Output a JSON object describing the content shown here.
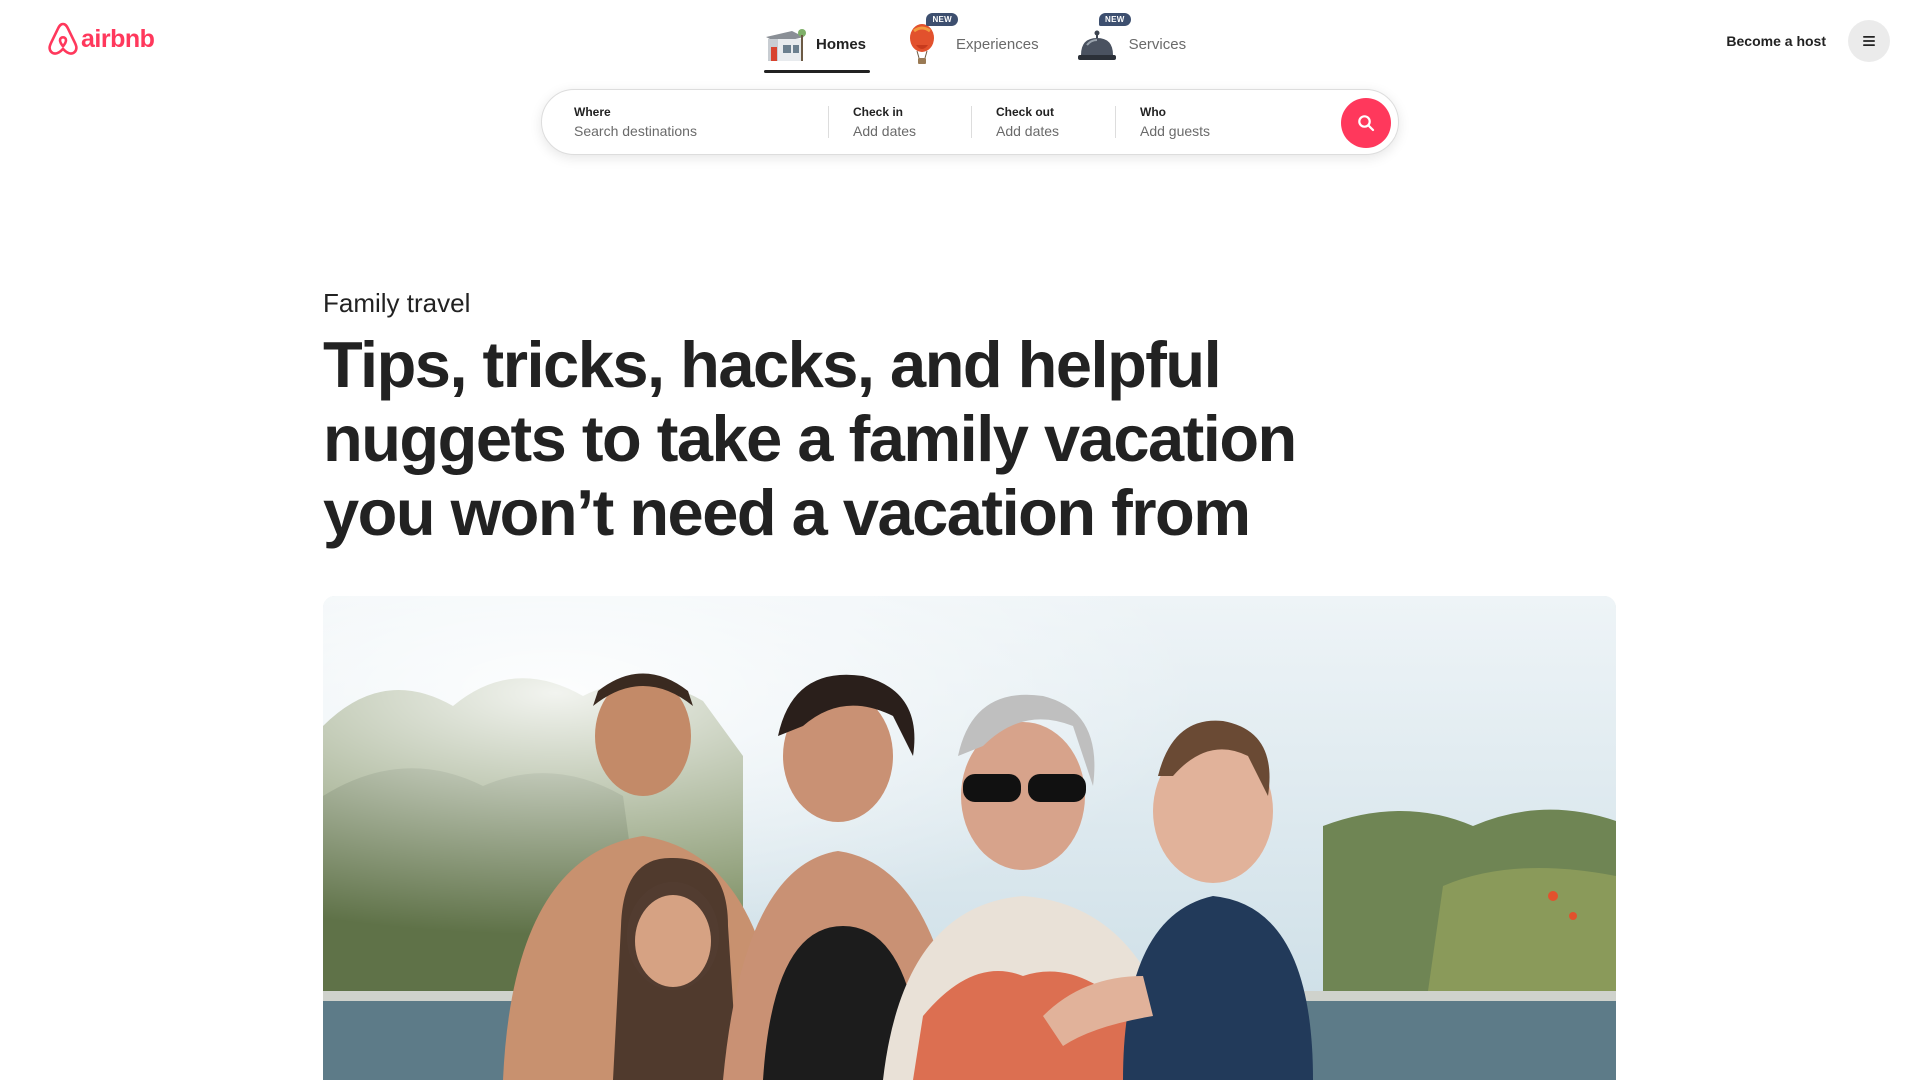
{
  "brand": {
    "name": "airbnb",
    "color": "#FF385C",
    "icon": "airbnb-logo-icon"
  },
  "nav": [
    {
      "label": "Homes",
      "icon": "house-icon",
      "active": true,
      "badge": ""
    },
    {
      "label": "Experiences",
      "icon": "hot-air-balloon-icon",
      "active": false,
      "badge": "NEW"
    },
    {
      "label": "Services",
      "icon": "service-bell-icon",
      "active": false,
      "badge": "NEW"
    }
  ],
  "header": {
    "host_label": "Become a host",
    "menu_icon": "hamburger-menu-icon"
  },
  "search": {
    "where": {
      "label": "Where",
      "placeholder": "Search destinations"
    },
    "check_in": {
      "label": "Check in",
      "placeholder": "Add dates"
    },
    "check_out": {
      "label": "Check out",
      "placeholder": "Add dates"
    },
    "who": {
      "label": "Who",
      "placeholder": "Add guests"
    },
    "button_icon": "search-icon"
  },
  "article": {
    "category": "Family travel",
    "title": "Tips, tricks, hacks, and helpful nuggets to take a family vacation you won’t need a vacation from"
  }
}
